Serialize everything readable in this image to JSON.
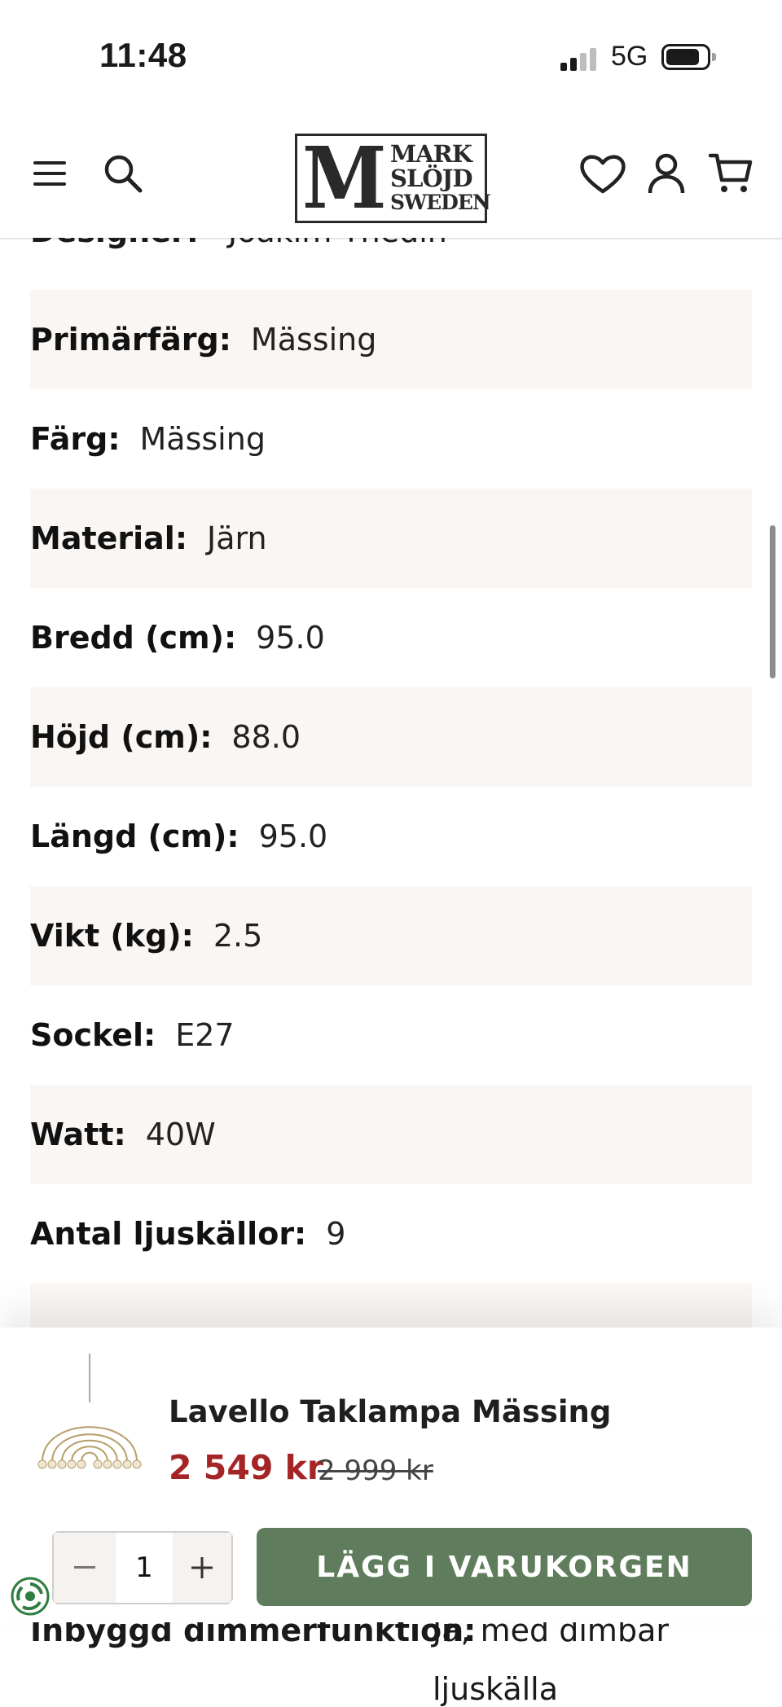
{
  "status_bar": {
    "time": "11:48",
    "network": "5G"
  },
  "header": {
    "logo": {
      "mark": "M",
      "line1": "MARK",
      "line2": "SLÖJD",
      "line3": "SWEDEN"
    }
  },
  "specs": {
    "clipped_top": {
      "label": "Designer:",
      "value": "Joakim Thedin"
    },
    "rows": [
      {
        "label": "Primärfärg:",
        "value": "Mässing"
      },
      {
        "label": "Färg:",
        "value": "Mässing"
      },
      {
        "label": "Material:",
        "value": "Järn"
      },
      {
        "label": "Bredd (cm):",
        "value": "95.0"
      },
      {
        "label": "Höjd (cm):",
        "value": "88.0"
      },
      {
        "label": "Längd (cm):",
        "value": "95.0"
      },
      {
        "label": "Vikt (kg):",
        "value": "2.5"
      },
      {
        "label": "Sockel:",
        "value": "E27"
      },
      {
        "label": "Watt:",
        "value": "40W"
      },
      {
        "label": "Antal ljuskällor:",
        "value": "9"
      }
    ]
  },
  "sticky_cart": {
    "product_title": "Lavello Taklampa Mässing",
    "price": "2 549 kr",
    "old_price": "2 999 kr",
    "quantity": "1",
    "add_button": "LÄGG I VARUKORGEN"
  },
  "below_panel": {
    "label": "Inbyggd dimmerfunktion:",
    "value_line1": "Ja, med dimbar",
    "value_line2": "ljuskälla"
  },
  "colors": {
    "price": "#a52527",
    "button": "#5f7d5c",
    "stripe": "#f9f6f3"
  }
}
